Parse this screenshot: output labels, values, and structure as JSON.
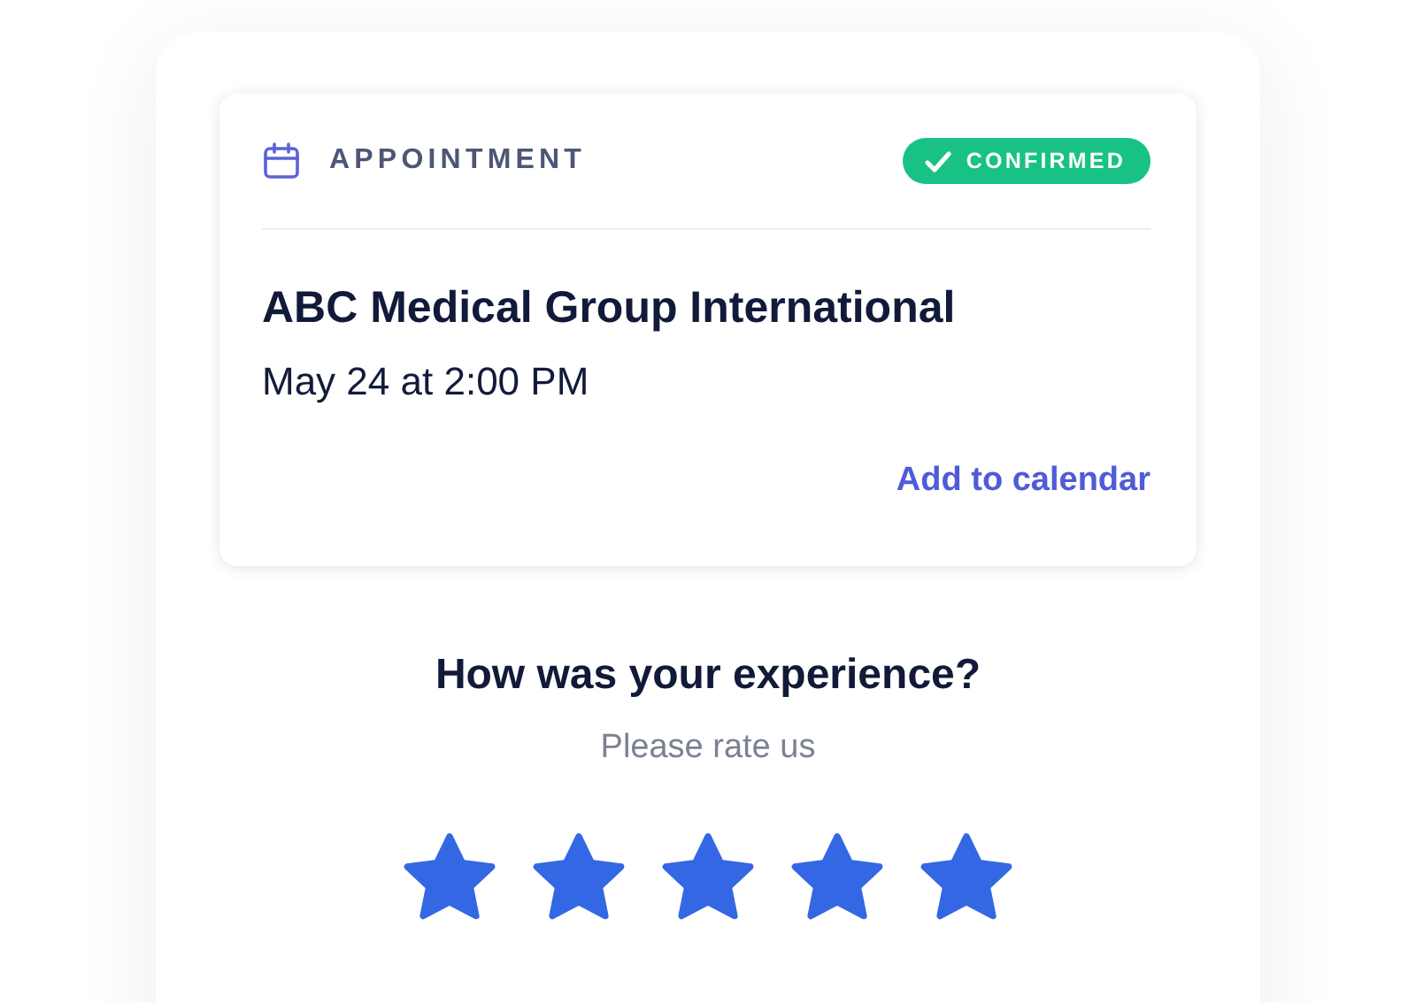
{
  "appointment": {
    "label": "APPOINTMENT",
    "status": {
      "text": "CONFIRMED",
      "confirmed": true
    },
    "provider": "ABC Medical Group International",
    "datetime": "May 24 at 2:00 PM",
    "action": "Add to calendar"
  },
  "rating": {
    "title": "How was your experience?",
    "subtitle": "Please rate us",
    "stars": 5
  }
}
